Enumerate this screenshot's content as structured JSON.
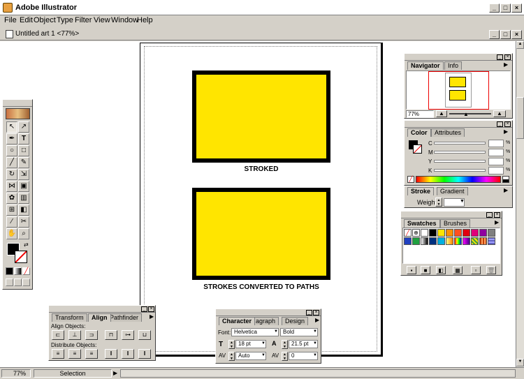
{
  "app": {
    "title": "Adobe Illustrator",
    "menu": [
      "File",
      "Edit",
      "Object",
      "Type",
      "Filter",
      "View",
      "Window",
      "Help"
    ]
  },
  "document": {
    "title": "Untitled art 1 <77%>",
    "label_stroked": "STROKED",
    "label_converted": "STROKES CONVERTED TO PATHS",
    "fill_color": "#ffe500"
  },
  "status": {
    "zoom": "77%",
    "tool": "Selection"
  },
  "navigator": {
    "tabs": [
      "Navigator",
      "Info"
    ],
    "zoom": "77%"
  },
  "color": {
    "tabs": [
      "Color",
      "Attributes"
    ],
    "channels": [
      "C",
      "M",
      "Y",
      "K"
    ],
    "unit": "%"
  },
  "stroke": {
    "tabs": [
      "Stroke",
      "Gradient"
    ],
    "weight_label": "Weight:"
  },
  "swatches": {
    "tabs": [
      "Swatches",
      "Brushes"
    ]
  },
  "align": {
    "tabs": [
      "Transform",
      "Align",
      "Pathfinder"
    ],
    "align_objects": "Align Objects:",
    "distribute_objects": "Distribute Objects:"
  },
  "character": {
    "tabs": [
      "Character",
      "agraph",
      "Design"
    ],
    "font_label": "Font:",
    "font": "Helvetica",
    "style": "Bold",
    "size": "18 pt",
    "leading": "21.5 pt",
    "kerning": "Auto",
    "tracking": "0"
  }
}
